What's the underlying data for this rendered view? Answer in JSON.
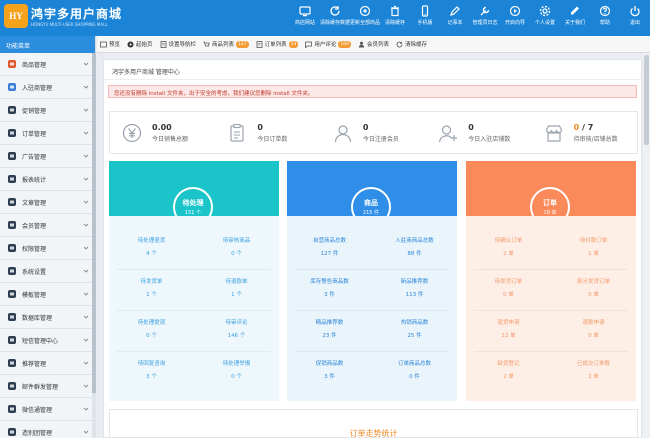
{
  "logo": {
    "badge": "HY",
    "title": "鸿宇多用户商城",
    "subtitle": "HONGYU MULTI-USER SHOPPING MALL"
  },
  "topnav": [
    {
      "label": "商店网站",
      "icon": "store-icon"
    },
    {
      "label": "清除缓存数据",
      "icon": "refresh-icon"
    },
    {
      "label": "更新全部商品",
      "icon": "sync-icon"
    },
    {
      "label": "清除缓存",
      "icon": "trash-icon"
    },
    {
      "label": "手机版",
      "icon": "mobile-icon"
    },
    {
      "label": "记事本",
      "icon": "note-icon"
    },
    {
      "label": "管理员日志",
      "icon": "wrench-icon"
    },
    {
      "label": "开启向导",
      "icon": "play-icon"
    },
    {
      "label": "个人设置",
      "icon": "gear-icon"
    },
    {
      "label": "关于我们",
      "icon": "pen-icon"
    },
    {
      "label": "帮助",
      "icon": "help-icon"
    },
    {
      "label": "退出",
      "icon": "power-icon"
    }
  ],
  "sidebar": {
    "title": "功能菜单",
    "items": [
      {
        "label": "商品管理",
        "icon": "bag-icon"
      },
      {
        "label": "入驻商管理",
        "icon": "user-plus-icon"
      },
      {
        "label": "促销管理",
        "icon": "tag-icon"
      },
      {
        "label": "订单管理",
        "icon": "order-icon"
      },
      {
        "label": "广告管理",
        "icon": "ad-icon"
      },
      {
        "label": "报表统计",
        "icon": "chart-icon"
      },
      {
        "label": "文章管理",
        "icon": "doc-icon"
      },
      {
        "label": "会员管理",
        "icon": "members-icon"
      },
      {
        "label": "权限管理",
        "icon": "key-icon"
      },
      {
        "label": "系统设置",
        "icon": "gear-icon"
      },
      {
        "label": "模板管理",
        "icon": "template-icon"
      },
      {
        "label": "数据库管理",
        "icon": "database-icon"
      },
      {
        "label": "短信管理中心",
        "icon": "message-icon"
      },
      {
        "label": "推荐管理",
        "icon": "recommend-icon"
      },
      {
        "label": "邮件群发管理",
        "icon": "mail-icon"
      },
      {
        "label": "微信通管理",
        "icon": "wechat-icon"
      },
      {
        "label": "造别团管理",
        "icon": "group-icon"
      }
    ]
  },
  "tabs": [
    {
      "label": "预览",
      "icon": "preview-icon"
    },
    {
      "label": "起始页",
      "icon": "play-icon"
    },
    {
      "label": "设置导航栏",
      "icon": "doc-icon"
    },
    {
      "label": "商品列表",
      "icon": "cart-icon",
      "badge": "127"
    },
    {
      "label": "订单列表",
      "icon": "order-icon",
      "badge": "13"
    },
    {
      "label": "用户评论",
      "icon": "comment-icon",
      "badge": "100"
    },
    {
      "label": "会员列表",
      "icon": "members-icon"
    },
    {
      "label": "清除缓存",
      "icon": "refresh-icon"
    }
  ],
  "main": {
    "title": "鸿宇多用户商城 管理中心",
    "alert": "您还没有删除 install 文件夹，出于安全的考虑，我们建议您删除 install 文件夹。"
  },
  "stats": [
    {
      "value": "0.00",
      "label": "今日销售总额",
      "icon": "yen-icon"
    },
    {
      "value": "0",
      "label": "今日订单数",
      "icon": "clipboard-icon"
    },
    {
      "value": "0",
      "label": "今日注册会员",
      "icon": "person-icon"
    },
    {
      "value": "0",
      "label": "今日入驻店铺数",
      "icon": "person-add-icon"
    },
    {
      "value_hl": "0",
      "value_rest": " / 7",
      "label": "待审核/店铺总数",
      "icon": "shop-icon"
    }
  ],
  "cards": [
    {
      "title": "待处理",
      "count": "151 个",
      "cells": [
        {
          "label": "待处理退货",
          "num": "4 个"
        },
        {
          "label": "待审核商品",
          "num": "0 个"
        },
        {
          "label": "待发货单",
          "num": "1 个"
        },
        {
          "label": "待退款单",
          "num": "1 个"
        },
        {
          "label": "待处理提现",
          "num": "0 个"
        },
        {
          "label": "待审评论",
          "num": "146 个"
        },
        {
          "label": "待回复咨询",
          "num": "3 个"
        },
        {
          "label": "待处理举报",
          "num": "0 个"
        }
      ]
    },
    {
      "title": "商品",
      "count": "215 件",
      "cells": [
        {
          "label": "自营商品总数",
          "num": "127 件"
        },
        {
          "label": "入驻商商品总数",
          "num": "88 件"
        },
        {
          "label": "库存警告商品数",
          "num": "3 件"
        },
        {
          "label": "新品推荐数",
          "num": "113 件"
        },
        {
          "label": "精品推荐数",
          "num": "23 件"
        },
        {
          "label": "热销商品数",
          "num": "25 件"
        },
        {
          "label": "促销商品数",
          "num": "3 件"
        },
        {
          "label": "订单商品总数",
          "num": "0 件"
        }
      ]
    },
    {
      "title": "订单",
      "count": "18 单",
      "cells": [
        {
          "label": "待确认订单",
          "num": "2 单"
        },
        {
          "label": "待付款订单",
          "num": "1 单"
        },
        {
          "label": "待发货订单",
          "num": "0 单"
        },
        {
          "label": "部分发货订单",
          "num": "0 单"
        },
        {
          "label": "退货申请",
          "num": "12 单"
        },
        {
          "label": "退款申请",
          "num": "0 单"
        },
        {
          "label": "缺货登记",
          "num": "2 单"
        },
        {
          "label": "已成交订单数",
          "num": "2 单"
        }
      ]
    }
  ],
  "bottom": {
    "title": "订单走势统计"
  }
}
